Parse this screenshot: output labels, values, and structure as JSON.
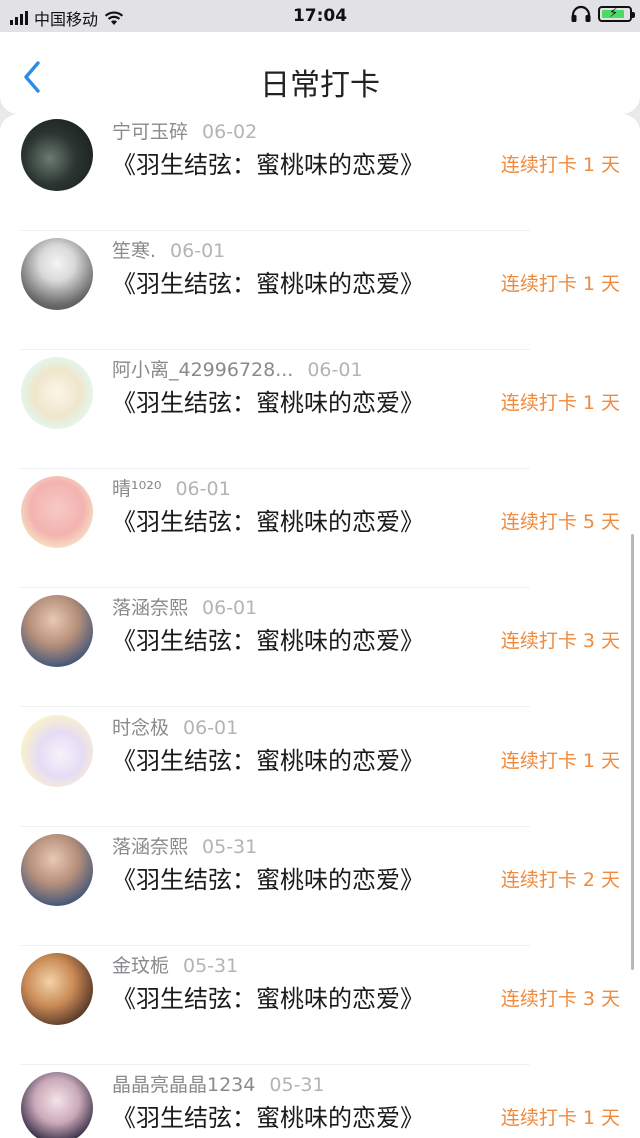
{
  "status_bar": {
    "carrier": "中国移动",
    "time": "17:04"
  },
  "nav": {
    "title": "日常打卡",
    "back_icon": "chevron-left-icon"
  },
  "colors": {
    "accent": "#f08a3c",
    "back": "#2d8ae6"
  },
  "entries": [
    {
      "user": "宁可玉碎",
      "date": "06-02",
      "book": "《羽生结弦：蜜桃味的恋爱》",
      "streak": "连续打卡 1 天"
    },
    {
      "user": "笙寒.",
      "date": "06-01",
      "book": "《羽生结弦：蜜桃味的恋爱》",
      "streak": "连续打卡 1 天"
    },
    {
      "user": "阿小离_42996728...",
      "date": "06-01",
      "book": "《羽生结弦：蜜桃味的恋爱》",
      "streak": "连续打卡 1 天"
    },
    {
      "user": "晴¹⁰²⁰",
      "date": "06-01",
      "book": "《羽生结弦：蜜桃味的恋爱》",
      "streak": "连续打卡 5 天"
    },
    {
      "user": "落涵奈熙",
      "date": "06-01",
      "book": "《羽生结弦：蜜桃味的恋爱》",
      "streak": "连续打卡 3 天"
    },
    {
      "user": "时念极",
      "date": "06-01",
      "book": "《羽生结弦：蜜桃味的恋爱》",
      "streak": "连续打卡 1 天"
    },
    {
      "user": "落涵奈熙",
      "date": "05-31",
      "book": "《羽生结弦：蜜桃味的恋爱》",
      "streak": "连续打卡 2 天"
    },
    {
      "user": "金玟栀",
      "date": "05-31",
      "book": "《羽生结弦：蜜桃味的恋爱》",
      "streak": "连续打卡 3 天"
    },
    {
      "user": "晶晶亮晶晶1234",
      "date": "05-31",
      "book": "《羽生结弦：蜜桃味的恋爱》",
      "streak": "连续打卡 1 天"
    }
  ]
}
